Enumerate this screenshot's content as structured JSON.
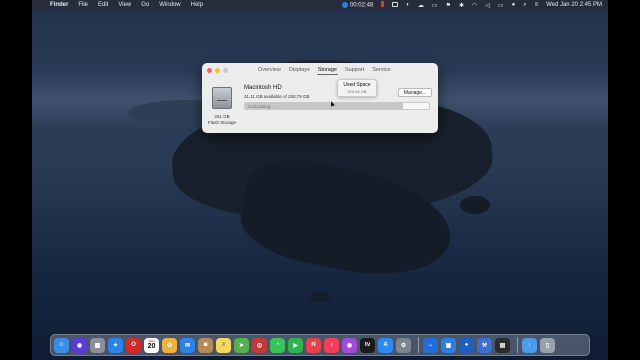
{
  "menubar": {
    "apple": "",
    "app_name": "Finder",
    "items": [
      "File",
      "Edit",
      "View",
      "Go",
      "Window",
      "Help"
    ],
    "recording_timer": "00:02:48",
    "datetime": "Wed Jan 20  2:45 PM"
  },
  "window": {
    "tabs": [
      "Overview",
      "Displays",
      "Storage",
      "Support",
      "Service"
    ],
    "active_tab": "Storage",
    "volume_name": "Macintosh HD",
    "volume_available": "31.11 GB available of 250.79 GB",
    "manage_label": "Manage...",
    "bar_label": "Calculating...",
    "bar_fill_percent": 86,
    "tooltip_title": "Used Space",
    "tooltip_value": "219.64 GB",
    "disk_size": "251 GB",
    "disk_type": "Flash Storage"
  },
  "dock": {
    "calendar_month": "JAN",
    "calendar_day": "20",
    "icons": [
      {
        "name": "finder-icon",
        "color": "#3a8ee6",
        "glyph": "☺"
      },
      {
        "name": "siri-icon",
        "color": "#5a3bd6",
        "glyph": "◉"
      },
      {
        "name": "launchpad-icon",
        "color": "#8a8f99",
        "glyph": "▦"
      },
      {
        "name": "safari-icon",
        "color": "#2a84e8",
        "glyph": "✦"
      },
      {
        "name": "opera-icon",
        "color": "#d42a2a",
        "glyph": "O"
      },
      {
        "name": "calendar-icon",
        "color": "#ffffff",
        "glyph": ""
      },
      {
        "name": "photos-icon",
        "color": "#f2b33d",
        "glyph": "✿"
      },
      {
        "name": "mail-icon",
        "color": "#2f82e6",
        "glyph": "✉"
      },
      {
        "name": "contacts-icon",
        "color": "#b58a5a",
        "glyph": "◙"
      },
      {
        "name": "notes-icon",
        "color": "#f5d860",
        "glyph": "≡"
      },
      {
        "name": "maps-icon",
        "color": "#55b04f",
        "glyph": "➤"
      },
      {
        "name": "photo-booth-icon",
        "color": "#c23b3b",
        "glyph": "◎"
      },
      {
        "name": "messages-icon",
        "color": "#39c45a",
        "glyph": "◔"
      },
      {
        "name": "facetime-icon",
        "color": "#2fb34b",
        "glyph": "▶"
      },
      {
        "name": "news-icon",
        "color": "#e8404c",
        "glyph": "N"
      },
      {
        "name": "music-icon",
        "color": "#f23d5b",
        "glyph": "♪"
      },
      {
        "name": "podcasts-icon",
        "color": "#a04ad8",
        "glyph": "◉"
      },
      {
        "name": "tv-icon",
        "color": "#1b1b1b",
        "glyph": "tv"
      },
      {
        "name": "app-store-icon",
        "color": "#2a8cf0",
        "glyph": "A"
      },
      {
        "name": "system-preferences-icon",
        "color": "#7d8591",
        "glyph": "⚙"
      },
      {
        "name": "teamviewer-icon",
        "color": "#1f6fd6",
        "glyph": "↔"
      },
      {
        "name": "screen-sharing-icon",
        "color": "#2d7fe0",
        "glyph": "▣"
      },
      {
        "name": "screen-recorder-icon",
        "color": "#1e5fbf",
        "glyph": "●"
      },
      {
        "name": "xcode-icon",
        "color": "#3d6fd0",
        "glyph": "⚒"
      },
      {
        "name": "screenshot-icon",
        "color": "#2c2c2c",
        "glyph": "▤"
      },
      {
        "name": "downloads-folder-icon",
        "color": "#4a9be8",
        "glyph": "↓"
      },
      {
        "name": "trash-icon",
        "color": "#9aa2ad",
        "glyph": "▯"
      }
    ]
  }
}
